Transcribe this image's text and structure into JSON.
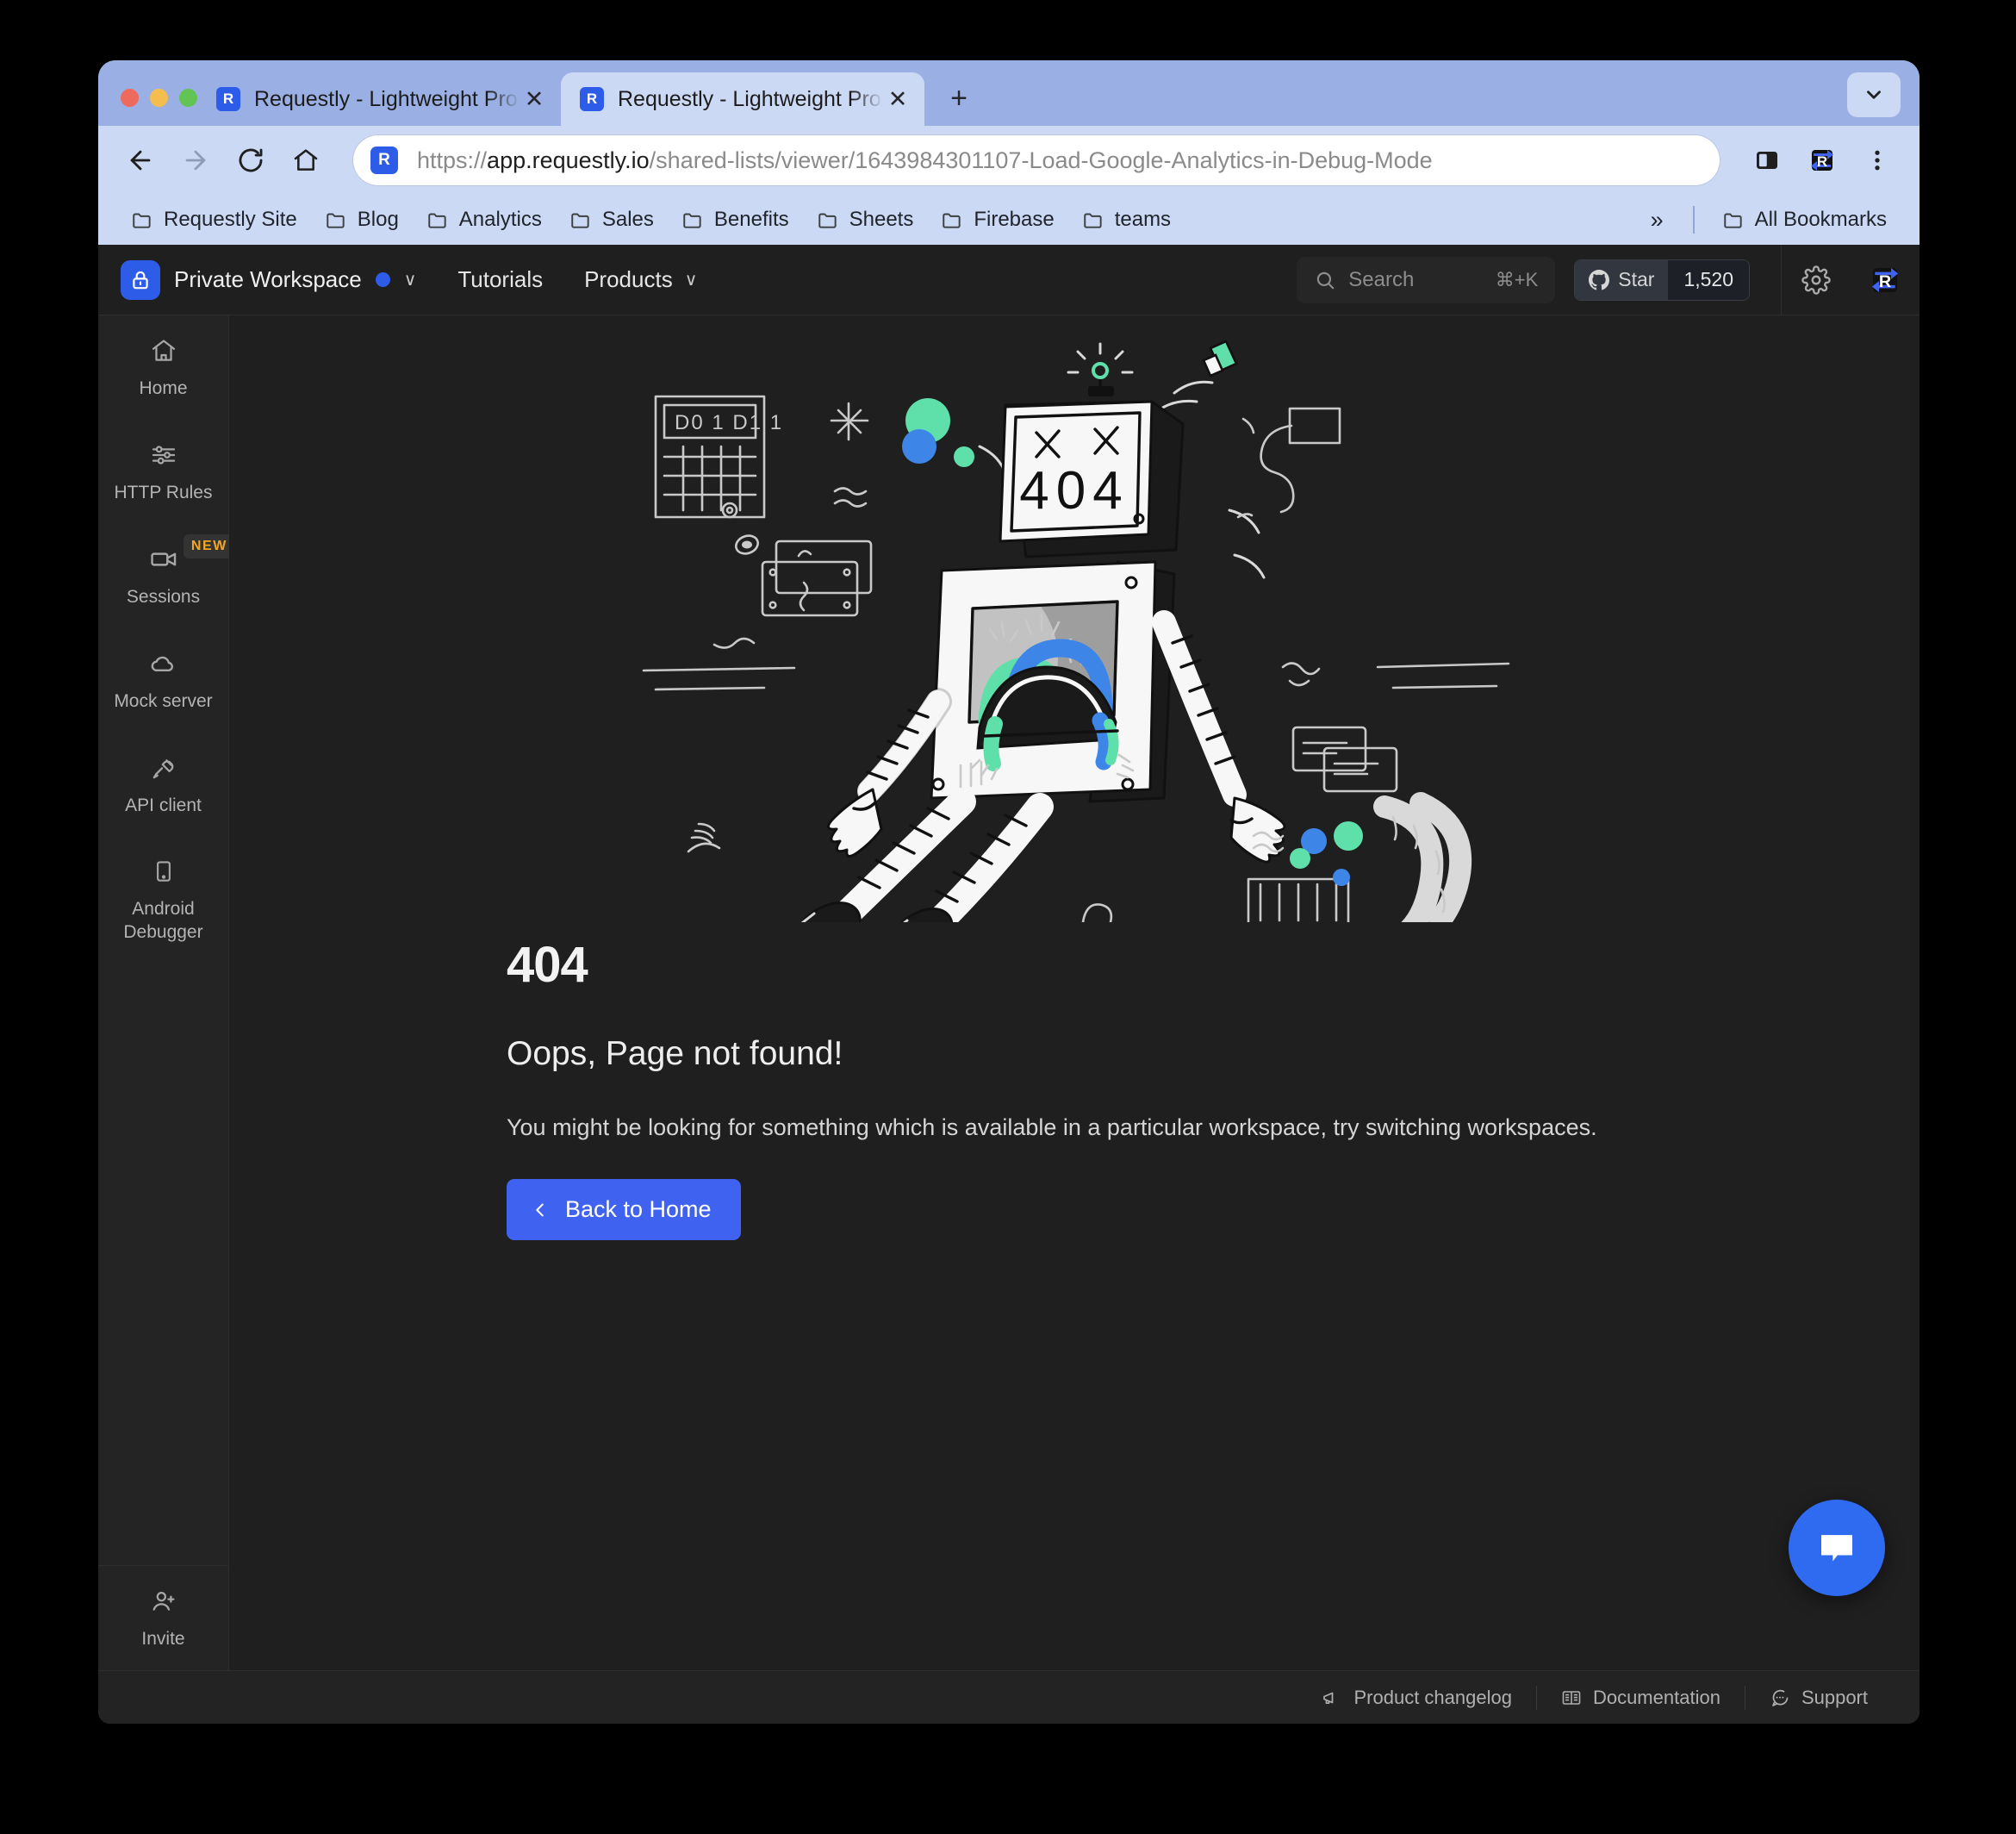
{
  "browser": {
    "tabs": [
      {
        "title": "Requestly - Lightweight Proxy",
        "favicon": "requestly-icon",
        "active": false
      },
      {
        "title": "Requestly - Lightweight Proxy",
        "favicon": "requestly-icon",
        "active": true
      }
    ],
    "new_tab_label": "+",
    "tab_close_label": "✕",
    "tab_list_icon": "chevron-down-icon",
    "nav": {
      "back": "←",
      "forward": "→",
      "reload": "⟳",
      "home": "home-icon"
    },
    "omnibox": {
      "url_scheme": "https://",
      "url_host": "app.requestly.io",
      "url_path": "/shared-lists/viewer/1643984301107-Load-Google-Analytics-in-Debug-Mode",
      "full_url": "https://app.requestly.io/shared-lists/viewer/1643984301107-Load-Google-Analytics-in-Debug-Mode"
    },
    "toolbar_icons": [
      "side-panel-icon",
      "requestly-extension-icon",
      "kebab-menu-icon"
    ],
    "bookmarks": [
      {
        "label": "Requestly Site",
        "icon": "folder-icon"
      },
      {
        "label": "Blog",
        "icon": "folder-icon"
      },
      {
        "label": "Analytics",
        "icon": "folder-icon"
      },
      {
        "label": "Sales",
        "icon": "folder-icon"
      },
      {
        "label": "Benefits",
        "icon": "folder-icon"
      },
      {
        "label": "Sheets",
        "icon": "folder-icon"
      },
      {
        "label": "Firebase",
        "icon": "folder-icon"
      },
      {
        "label": "teams",
        "icon": "folder-icon"
      }
    ],
    "bookmarks_overflow": "»",
    "all_bookmarks_label": "All Bookmarks"
  },
  "app_header": {
    "workspace_name": "Private Workspace",
    "workspace_icon": "lock-icon",
    "workspace_chevron": "∨",
    "nav_links": [
      {
        "label": "Tutorials",
        "has_chevron": false
      },
      {
        "label": "Products",
        "has_chevron": true
      }
    ],
    "chevron": "∨",
    "search": {
      "placeholder": "Search",
      "shortcut": "⌘+K",
      "icon": "search-icon"
    },
    "github_star": {
      "label": "Star",
      "count": "1,520",
      "icon": "github-icon"
    },
    "icons": [
      "gear-icon",
      "requestly-logo-icon"
    ]
  },
  "sidebar": {
    "items": [
      {
        "label": "Home",
        "icon": "home-icon",
        "badge": null
      },
      {
        "label": "HTTP Rules",
        "icon": "sliders-icon",
        "badge": null
      },
      {
        "label": "Sessions",
        "icon": "video-camera-icon",
        "badge": "NEW"
      },
      {
        "label": "Mock server",
        "icon": "cloud-icon",
        "badge": null
      },
      {
        "label": "API client",
        "icon": "plug-icon",
        "badge": null
      },
      {
        "label": "Android Debugger",
        "icon": "mobile-icon",
        "badge": null
      }
    ],
    "bottom": {
      "label": "Invite",
      "icon": "user-plus-icon"
    }
  },
  "main": {
    "illustration": "broken-robot-404-illustration",
    "error_code": "404",
    "error_title": "Oops, Page not found!",
    "error_description": "You might be looking for something which is available in a particular workspace, try switching workspaces.",
    "back_button_label": "Back to Home",
    "back_button_icon": "chevron-left-icon"
  },
  "footer": {
    "links": [
      {
        "label": "Product changelog",
        "icon": "megaphone-icon"
      },
      {
        "label": "Documentation",
        "icon": "book-icon"
      },
      {
        "label": "Support",
        "icon": "chat-dots-icon"
      }
    ]
  },
  "chat_widget": {
    "icon": "chat-bubble-icon"
  },
  "colors": {
    "accent_blue": "#3f63f0",
    "brand_blue": "#2d5ce8",
    "app_bg": "#1f1f1f",
    "sidebar_bg": "#242424",
    "browser_chrome": "#ccd9f5",
    "tabstrip": "#9ab0e4",
    "badge_orange": "#f5a623",
    "robot_green": "#5fe0ab",
    "robot_blue": "#3d86e8"
  }
}
